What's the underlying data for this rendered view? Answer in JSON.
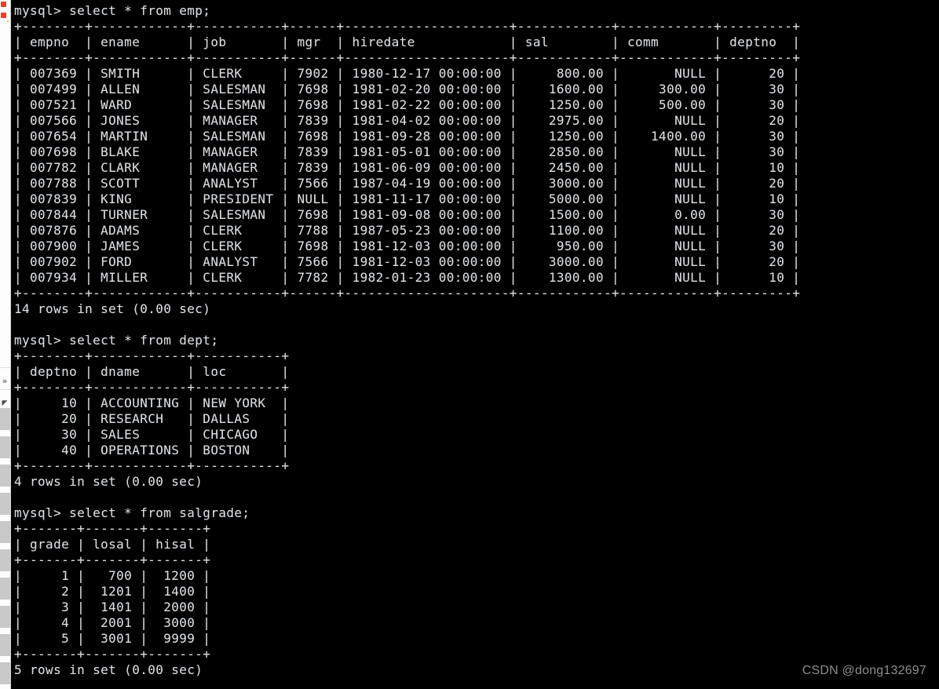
{
  "terminal": {
    "prompt": "mysql> ",
    "foreground_color": "#d8dce0",
    "background_color": "#000000",
    "blocks": [
      {
        "command": "select * from emp;",
        "table": {
          "columns": [
            "empno",
            "ename",
            "job",
            "mgr",
            "hiredate",
            "sal",
            "comm",
            "deptno"
          ],
          "widths": [
            6,
            10,
            9,
            4,
            19,
            10,
            10,
            7
          ],
          "aligns": [
            "right",
            "left",
            "left",
            "left",
            "left",
            "right",
            "right",
            "right"
          ],
          "rows": [
            [
              "007369",
              "SMITH",
              "CLERK",
              "7902",
              "1980-12-17 00:00:00",
              "800.00",
              "NULL",
              "20"
            ],
            [
              "007499",
              "ALLEN",
              "SALESMAN",
              "7698",
              "1981-02-20 00:00:00",
              "1600.00",
              "300.00",
              "30"
            ],
            [
              "007521",
              "WARD",
              "SALESMAN",
              "7698",
              "1981-02-22 00:00:00",
              "1250.00",
              "500.00",
              "30"
            ],
            [
              "007566",
              "JONES",
              "MANAGER",
              "7839",
              "1981-04-02 00:00:00",
              "2975.00",
              "NULL",
              "20"
            ],
            [
              "007654",
              "MARTIN",
              "SALESMAN",
              "7698",
              "1981-09-28 00:00:00",
              "1250.00",
              "1400.00",
              "30"
            ],
            [
              "007698",
              "BLAKE",
              "MANAGER",
              "7839",
              "1981-05-01 00:00:00",
              "2850.00",
              "NULL",
              "30"
            ],
            [
              "007782",
              "CLARK",
              "MANAGER",
              "7839",
              "1981-06-09 00:00:00",
              "2450.00",
              "NULL",
              "10"
            ],
            [
              "007788",
              "SCOTT",
              "ANALYST",
              "7566",
              "1987-04-19 00:00:00",
              "3000.00",
              "NULL",
              "20"
            ],
            [
              "007839",
              "KING",
              "PRESIDENT",
              "NULL",
              "1981-11-17 00:00:00",
              "5000.00",
              "NULL",
              "10"
            ],
            [
              "007844",
              "TURNER",
              "SALESMAN",
              "7698",
              "1981-09-08 00:00:00",
              "1500.00",
              "0.00",
              "30"
            ],
            [
              "007876",
              "ADAMS",
              "CLERK",
              "7788",
              "1987-05-23 00:00:00",
              "1100.00",
              "NULL",
              "20"
            ],
            [
              "007900",
              "JAMES",
              "CLERK",
              "7698",
              "1981-12-03 00:00:00",
              "950.00",
              "NULL",
              "30"
            ],
            [
              "007902",
              "FORD",
              "ANALYST",
              "7566",
              "1981-12-03 00:00:00",
              "3000.00",
              "NULL",
              "20"
            ],
            [
              "007934",
              "MILLER",
              "CLERK",
              "7782",
              "1982-01-23 00:00:00",
              "1300.00",
              "NULL",
              "10"
            ]
          ]
        },
        "status": "14 rows in set (0.00 sec)"
      },
      {
        "command": "select * from dept;",
        "table": {
          "columns": [
            "deptno",
            "dname",
            "loc"
          ],
          "widths": [
            6,
            10,
            9
          ],
          "aligns": [
            "right",
            "left",
            "left"
          ],
          "rows": [
            [
              "10",
              "ACCOUNTING",
              "NEW YORK"
            ],
            [
              "20",
              "RESEARCH",
              "DALLAS"
            ],
            [
              "30",
              "SALES",
              "CHICAGO"
            ],
            [
              "40",
              "OPERATIONS",
              "BOSTON"
            ]
          ]
        },
        "status": "4 rows in set (0.00 sec)"
      },
      {
        "command": "select * from salgrade;",
        "table": {
          "columns": [
            "grade",
            "losal",
            "hisal"
          ],
          "widths": [
            5,
            5,
            5
          ],
          "aligns": [
            "right",
            "right",
            "right"
          ],
          "rows": [
            [
              "1",
              "700",
              "1200"
            ],
            [
              "2",
              "1201",
              "1400"
            ],
            [
              "3",
              "1401",
              "2000"
            ],
            [
              "4",
              "2001",
              "3000"
            ],
            [
              "5",
              "3001",
              "9999"
            ]
          ]
        },
        "status": "5 rows in set (0.00 sec)"
      }
    ]
  },
  "sidebar": {
    "chevron_glyph": "»",
    "triangle_glyph": "◤",
    "block_color": "#c9c9c9",
    "marker_color": "#e8402a"
  },
  "watermark": {
    "text": "CSDN @dong132697",
    "color": "#8d8d8d"
  }
}
